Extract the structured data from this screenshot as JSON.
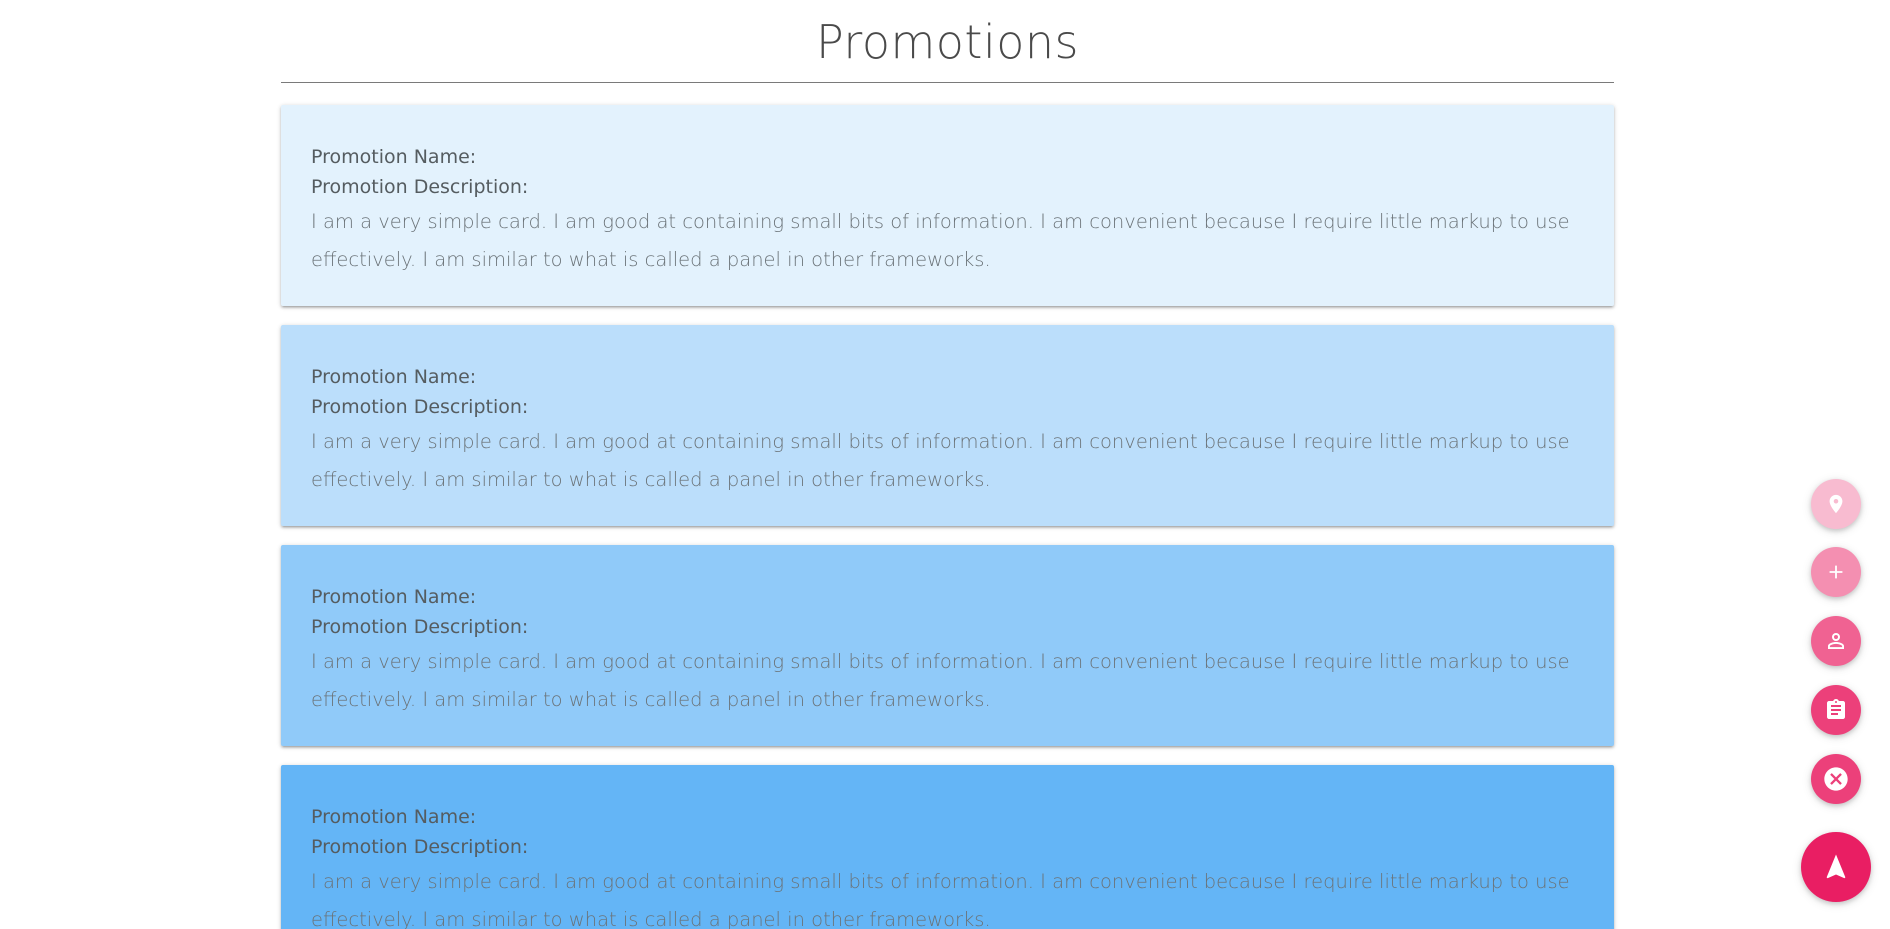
{
  "page": {
    "title": "Promotions"
  },
  "cards": [
    {
      "name_label": "Promotion Name:",
      "description_label": "Promotion Description:",
      "body": "I am a very simple card. I am good at containing small bits of information. I am convenient because I require little markup to use effectively. I am similar to what is called a panel in other frameworks.",
      "color": "#e3f2fd"
    },
    {
      "name_label": "Promotion Name:",
      "description_label": "Promotion Description:",
      "body": "I am a very simple card. I am good at containing small bits of information. I am convenient because I require little markup to use effectively. I am similar to what is called a panel in other frameworks.",
      "color": "#bbdefb"
    },
    {
      "name_label": "Promotion Name:",
      "description_label": "Promotion Description:",
      "body": "I am a very simple card. I am good at containing small bits of information. I am convenient because I require little markup to use effectively. I am similar to what is called a panel in other frameworks.",
      "color": "#90caf9"
    },
    {
      "name_label": "Promotion Name:",
      "description_label": "Promotion Description:",
      "body": "I am a very simple card. I am good at containing small bits of information. I am convenient because I require little markup to use effectively. I am similar to what is called a panel in other frameworks.",
      "color": "#64b5f6"
    }
  ],
  "fab_menu": {
    "buttons": [
      {
        "icon": "location-pin-icon",
        "color": "#f8bbd0"
      },
      {
        "icon": "add-icon",
        "color": "#f48fb1"
      },
      {
        "icon": "person-icon",
        "color": "#f06292"
      },
      {
        "icon": "clipboard-icon",
        "color": "#ec407a"
      },
      {
        "icon": "close-circle-icon",
        "color": "#ec407a"
      }
    ],
    "main_button": {
      "icon": "navigation-arrow-icon",
      "color": "#e91e63"
    }
  }
}
